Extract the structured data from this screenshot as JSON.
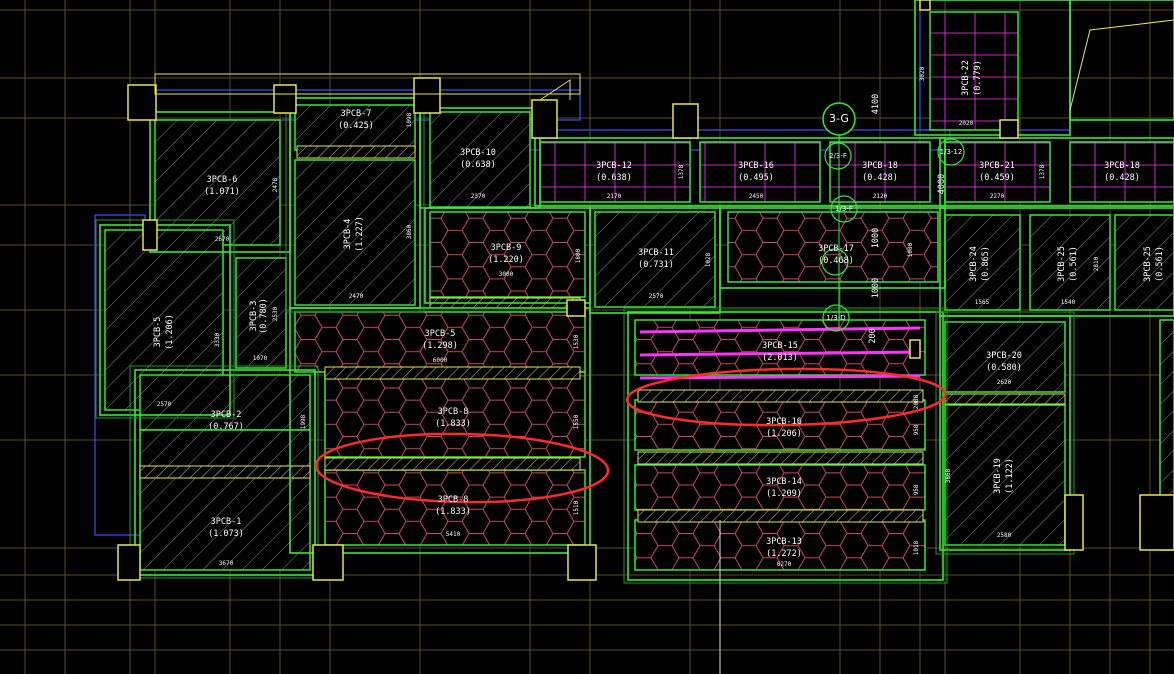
{
  "colors": {
    "background": "#000000",
    "grid_line": "#5a4a2c",
    "wall_green": "#34e834",
    "wall_dim_green": "#1f9a1f",
    "column_yellow": "#e6e64a",
    "beam_blue": "#3a50ff",
    "hex_pattern": "#c84a5e",
    "hatch_gray": "#8a8a8a",
    "magenta": "#ff33ff",
    "highlight_red": "#ff2a2a",
    "text": "#ffffff"
  },
  "axis_bubbles": [
    {
      "id": "3-G",
      "label": "3-G"
    },
    {
      "id": "2/3-F",
      "label": "2/3-F"
    },
    {
      "id": "1/3-F",
      "label": "1/3-F"
    },
    {
      "id": "1/3-D",
      "label": "1/3-D"
    },
    {
      "id": "1/3-12",
      "label": "1/3-12"
    }
  ],
  "panels": [
    {
      "id": "p6",
      "name": "3PCB-6",
      "area": "(1.071)",
      "dim_w": "2670",
      "dim_h": "2478",
      "pattern": "hatch"
    },
    {
      "id": "p7",
      "name": "3PCB-7",
      "area": "(0.425)",
      "dim_w": "",
      "dim_h": "1098",
      "pattern": "hatch"
    },
    {
      "id": "p4",
      "name": "3PCB-4",
      "area": "(1.227)",
      "dim_w": "2470",
      "dim_h": "3860",
      "pattern": "hatch"
    },
    {
      "id": "p10",
      "name": "3PCB-10",
      "area": "(0.638)",
      "dim_w": "2370",
      "dim_h": "",
      "pattern": "hatch"
    },
    {
      "id": "p9",
      "name": "3PCB-9",
      "area": "(1.220)",
      "dim_w": "3000",
      "dim_h": "1800",
      "pattern": "hex"
    },
    {
      "id": "p3",
      "name": "3PCB-3",
      "area": "(0.780)",
      "dim_w": "1070",
      "dim_h": "2530",
      "pattern": "hatch"
    },
    {
      "id": "p5",
      "name": "3PCB-5",
      "area": "(1.298)",
      "dim_w": "6000",
      "dim_h": "1530",
      "pattern": "hex"
    },
    {
      "id": "p8a",
      "name": "3PCB-8",
      "area": "(1.833)",
      "dim_w": "",
      "dim_h": "1550",
      "pattern": "hex"
    },
    {
      "id": "p8b",
      "name": "3PCB-8",
      "area": "(1.833)",
      "dim_w": "5410",
      "dim_h": "1510",
      "pattern": "hex"
    },
    {
      "id": "p2",
      "name": "3PCB-2",
      "area": "(0.767)",
      "dim_w": "",
      "dim_h": "1998",
      "pattern": "hatch"
    },
    {
      "id": "p1",
      "name": "3PCB-1",
      "area": "(1.073)",
      "dim_w": "3670",
      "dim_h": "",
      "pattern": "hatch"
    },
    {
      "id": "p5b",
      "name": "3PCB-5",
      "area": "(1.206)",
      "dim_w": "2570",
      "dim_h": "3330",
      "pattern": "hatch"
    },
    {
      "id": "p11",
      "name": "3PCB-11",
      "area": "(0.731)",
      "dim_w": "2570",
      "dim_h": "1028",
      "pattern": "hatch"
    },
    {
      "id": "p12",
      "name": "3PCB-12",
      "area": "(0.638)",
      "dim_w": "2170",
      "dim_h": "1378",
      "pattern": "magenta"
    },
    {
      "id": "p16",
      "name": "3PCB-16",
      "area": "(0.495)",
      "dim_w": "2450",
      "dim_h": "",
      "pattern": "magenta"
    },
    {
      "id": "p18",
      "name": "3PCB-18",
      "area": "(0.428)",
      "dim_w": "2120",
      "dim_h": "",
      "pattern": "magenta"
    },
    {
      "id": "p21",
      "name": "3PCB-21",
      "area": "(0.459)",
      "dim_w": "2270",
      "dim_h": "1378",
      "pattern": "magenta"
    },
    {
      "id": "p18b",
      "name": "3PCB-18",
      "area": "(0.428)",
      "dim_w": "",
      "dim_h": "",
      "pattern": "magenta"
    },
    {
      "id": "p22",
      "name": "3PCB-22",
      "area": "(0.779)",
      "dim_w": "2020",
      "dim_h": "3020",
      "pattern": "magenta"
    },
    {
      "id": "p17",
      "name": "3PCB-17",
      "area": "(0.468)",
      "dim_w": "",
      "dim_h": "1000",
      "pattern": "hex"
    },
    {
      "id": "p15",
      "name": "3PCB-15",
      "area": "(2.013)",
      "dim_w": "",
      "dim_h": "2088",
      "pattern": "hex"
    },
    {
      "id": "p16b",
      "name": "3PCB-16",
      "area": "(1.206)",
      "dim_w": "",
      "dim_h": "958",
      "pattern": "hex"
    },
    {
      "id": "p14",
      "name": "3PCB-14",
      "area": "(1.209)",
      "dim_w": "",
      "dim_h": "958",
      "pattern": "hex"
    },
    {
      "id": "p13",
      "name": "3PCB-13",
      "area": "(1.272)",
      "dim_w": "6270",
      "dim_h": "1018",
      "pattern": "hex"
    },
    {
      "id": "p24",
      "name": "3PCB-24",
      "area": "(0.865)",
      "dim_w": "1565",
      "dim_h": "",
      "pattern": "hatch"
    },
    {
      "id": "p25",
      "name": "3PCB-25",
      "area": "(0.561)",
      "dim_w": "1540",
      "dim_h": "2810",
      "pattern": "hatch"
    },
    {
      "id": "p25b",
      "name": "3PCB-25",
      "area": "(0.561)",
      "dim_w": "",
      "dim_h": "",
      "pattern": "hatch"
    },
    {
      "id": "p20",
      "name": "3PCB-20",
      "area": "(0.580)",
      "dim_w": "2620",
      "dim_h": "",
      "pattern": "hatch"
    },
    {
      "id": "p19",
      "name": "3PCB-19",
      "area": "(1.122)",
      "dim_w": "2580",
      "dim_h": "3868",
      "pattern": "hatch"
    }
  ],
  "dimensions": [
    {
      "id": "d4100",
      "text": "4100"
    },
    {
      "id": "d4000",
      "text": "4000"
    },
    {
      "id": "d1000a",
      "text": "1000"
    },
    {
      "id": "d1000b",
      "text": "1000"
    },
    {
      "id": "d200",
      "text": "200"
    }
  ]
}
